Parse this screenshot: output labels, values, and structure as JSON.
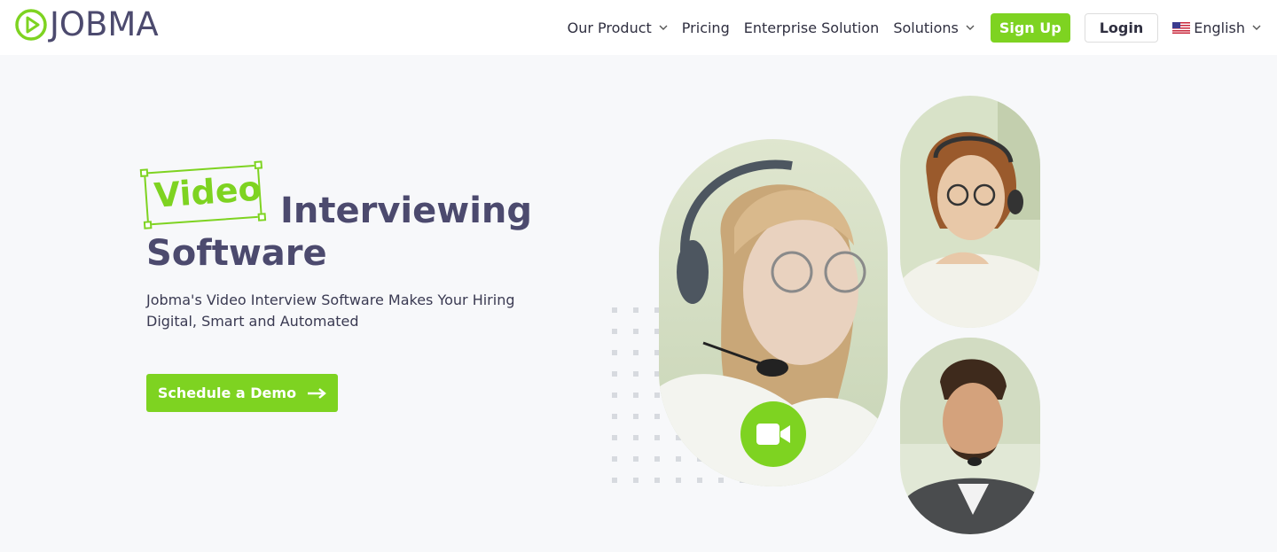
{
  "brand": {
    "name": "JOBMA",
    "accent": "#7ed321",
    "text_color": "#4c4a6e"
  },
  "nav": {
    "items": [
      {
        "label": "Our Product",
        "has_dropdown": true
      },
      {
        "label": "Pricing",
        "has_dropdown": false
      },
      {
        "label": "Enterprise Solution",
        "has_dropdown": false
      },
      {
        "label": "Solutions",
        "has_dropdown": true
      }
    ],
    "signup_label": "Sign Up",
    "login_label": "Login",
    "language_label": "English",
    "language_icon": "us-flag-icon"
  },
  "hero": {
    "highlight_word": "Video",
    "title_rest": "Interviewing",
    "title_line2": "Software",
    "subtitle": "Jobma's Video Interview Software Makes Your Hiring Digital, Smart and Automated",
    "cta_label": "Schedule a Demo",
    "cta_icon": "arrow-right-icon"
  },
  "media": {
    "main_photo": "woman-with-headset-photo",
    "top_photo": "smiling-woman-headset-photo",
    "bottom_photo": "man-with-headset-photo",
    "badge_icon": "video-camera-icon"
  }
}
